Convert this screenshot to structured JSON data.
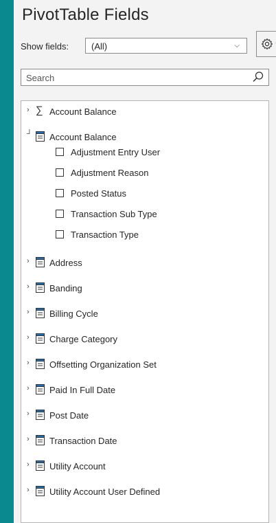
{
  "panel": {
    "title": "PivotTable Fields"
  },
  "show_fields": {
    "label": "Show fields:",
    "value": "(All)"
  },
  "search": {
    "placeholder": "Search"
  },
  "fields": [
    {
      "label": "Account Balance",
      "icon": "sigma-icon",
      "expanded": false
    },
    {
      "label": "Account Balance",
      "icon": "table-icon",
      "expanded": true,
      "children": [
        "Adjustment Entry User",
        "Adjustment Reason",
        "Posted Status",
        "Transaction Sub Type",
        "Transaction Type"
      ]
    },
    {
      "label": "Address",
      "icon": "table-icon",
      "expanded": false
    },
    {
      "label": "Banding",
      "icon": "table-icon",
      "expanded": false
    },
    {
      "label": "Billing Cycle",
      "icon": "table-icon",
      "expanded": false
    },
    {
      "label": "Charge Category",
      "icon": "table-icon",
      "expanded": false
    },
    {
      "label": "Offsetting Organization Set",
      "icon": "table-icon",
      "expanded": false
    },
    {
      "label": "Paid In Full Date",
      "icon": "table-icon",
      "expanded": false
    },
    {
      "label": "Post Date",
      "icon": "table-icon",
      "expanded": false
    },
    {
      "label": "Transaction Date",
      "icon": "table-icon",
      "expanded": false
    },
    {
      "label": "Utility Account",
      "icon": "table-icon",
      "expanded": false
    },
    {
      "label": "Utility Account User Defined",
      "icon": "table-icon",
      "expanded": false
    }
  ]
}
